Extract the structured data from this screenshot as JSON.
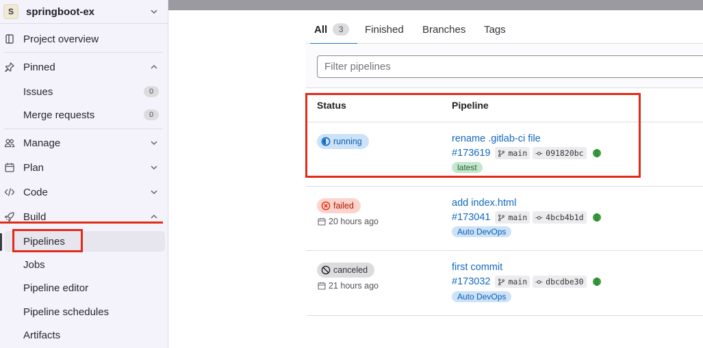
{
  "project": {
    "avatar_letter": "S",
    "name": "springboot-ex"
  },
  "sidebar": {
    "project_overview": "Project overview",
    "pinned": {
      "label": "Pinned",
      "items": [
        {
          "label": "Issues",
          "count": "0"
        },
        {
          "label": "Merge requests",
          "count": "0"
        }
      ]
    },
    "manage": "Manage",
    "plan": "Plan",
    "code": "Code",
    "build": "Build",
    "build_items": [
      "Pipelines",
      "Jobs",
      "Pipeline editor",
      "Pipeline schedules",
      "Artifacts"
    ]
  },
  "tabs": [
    {
      "label": "All",
      "count": "3"
    },
    {
      "label": "Finished"
    },
    {
      "label": "Branches"
    },
    {
      "label": "Tags"
    }
  ],
  "filter": {
    "placeholder": "Filter pipelines"
  },
  "table": {
    "headers": {
      "status": "Status",
      "pipeline": "Pipeline"
    },
    "rows": [
      {
        "status": "running",
        "time_ago": "",
        "title": "rename .gitlab-ci file",
        "id": "#173619",
        "branch": "main",
        "sha": "091820bc",
        "label": "latest"
      },
      {
        "status": "failed",
        "time_ago": "20 hours ago",
        "title": "add index.html",
        "id": "#173041",
        "branch": "main",
        "sha": "4bcb4b1d",
        "label": "Auto DevOps"
      },
      {
        "status": "canceled",
        "time_ago": "21 hours ago",
        "title": "first commit",
        "id": "#173032",
        "branch": "main",
        "sha": "dbcdbe30",
        "label": "Auto DevOps"
      }
    ]
  },
  "colors": {
    "link": "#1068bf",
    "annotation": "#e22b16",
    "sidebar_bg": "#f4f3fb"
  }
}
